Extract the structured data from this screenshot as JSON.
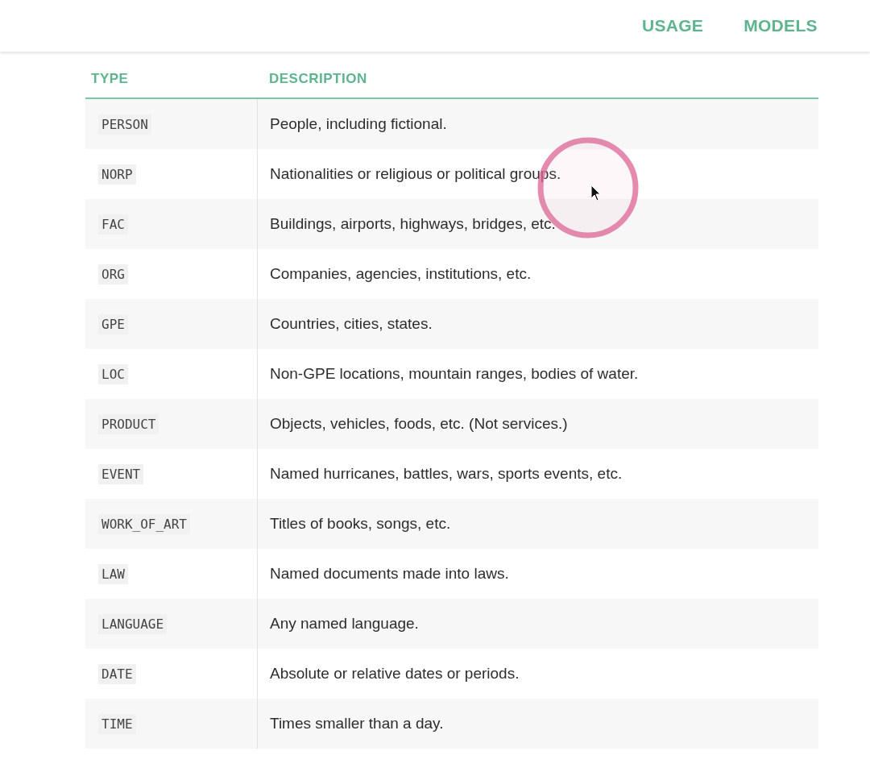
{
  "nav": [
    {
      "label": "USAGE"
    },
    {
      "label": "MODELS"
    }
  ],
  "table": {
    "columns": [
      "TYPE",
      "DESCRIPTION"
    ],
    "rows": [
      {
        "type": "PERSON",
        "description": "People, including fictional."
      },
      {
        "type": "NORP",
        "description": "Nationalities or religious or political groups."
      },
      {
        "type": "FAC",
        "description": "Buildings, airports, highways, bridges, etc."
      },
      {
        "type": "ORG",
        "description": "Companies, agencies, institutions, etc."
      },
      {
        "type": "GPE",
        "description": "Countries, cities, states."
      },
      {
        "type": "LOC",
        "description": "Non-GPE locations, mountain ranges, bodies of water."
      },
      {
        "type": "PRODUCT",
        "description": "Objects, vehicles, foods, etc. (Not services.)"
      },
      {
        "type": "EVENT",
        "description": "Named hurricanes, battles, wars, sports events, etc."
      },
      {
        "type": "WORK_OF_ART",
        "description": "Titles of books, songs, etc."
      },
      {
        "type": "LAW",
        "description": "Named documents made into laws."
      },
      {
        "type": "LANGUAGE",
        "description": "Any named language."
      },
      {
        "type": "DATE",
        "description": "Absolute or relative dates or periods."
      },
      {
        "type": "TIME",
        "description": "Times smaller than a day."
      }
    ]
  }
}
